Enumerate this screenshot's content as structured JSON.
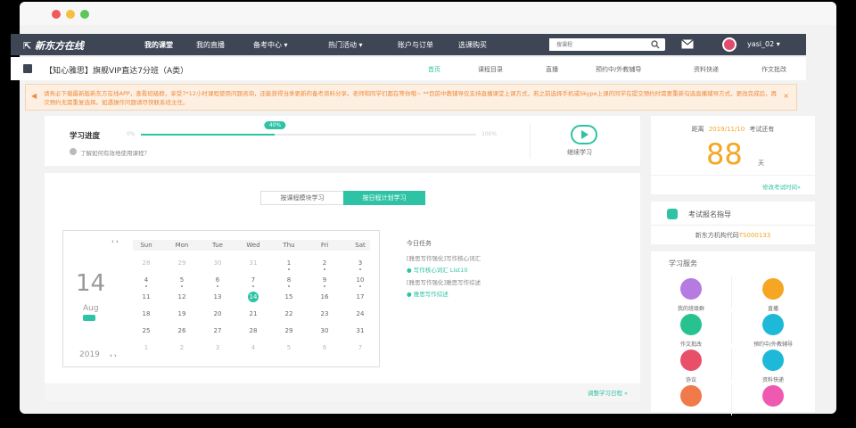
{
  "topnav": {
    "logo": "新东方在线",
    "items": [
      "我的课堂",
      "我的直播",
      "备考中心 ▾",
      "热门活动 ▾",
      "账户与订单",
      "选课购买"
    ],
    "search_placeholder": "搜课程",
    "username": "yasi_02 ▾"
  },
  "subheader": {
    "course_title": "【知心雅思】旗舰VIP直达7分班（A类）",
    "tabs": [
      "首页",
      "课程目录",
      "直播",
      "预约中/外教辅导",
      "资料快递",
      "作文批改"
    ]
  },
  "notice": {
    "text": "请务必下载最新版新东方在线APP，查看班级群，享受7*12小时课程使用问题咨询，还能获得当季更新的备考资料分享。老师和同学们都在等你哦~ **目前中教辅导仅支持直播课堂上课方式，若之前选择手机或Skype上课的同学在提交预约时需要重新勾选直播辅导方式，更改完成后，再次预约无需重复选择。如遇操作问题请尽快联系班主任。",
    "close": "×"
  },
  "progress": {
    "title": "学习进度",
    "percent": 0.4,
    "percent_label": "40%",
    "start_label": "0%",
    "end_label": "100%",
    "help": "了解如何有效地使用课程？",
    "continue": "继续学习"
  },
  "exam": {
    "prefix": "距离",
    "date": "2019/11/10",
    "suffix": "考试还有",
    "days": "88",
    "unit": "天",
    "edit": "修改考试时间»"
  },
  "mode_tabs": [
    "按课程模块学习",
    "按日程计划学习"
  ],
  "calendar": {
    "day": "14",
    "month": "Aug",
    "year": "2019",
    "weekdays": [
      "Sun",
      "Mon",
      "Tue",
      "Wed",
      "Thu",
      "Fri",
      "Sat"
    ],
    "rows": [
      [
        "28",
        "29",
        "30",
        "31",
        "1",
        "2",
        "3"
      ],
      [
        "4",
        "5",
        "6",
        "7",
        "8",
        "9",
        "10"
      ],
      [
        "11",
        "12",
        "13",
        "14",
        "15",
        "16",
        "17"
      ],
      [
        "18",
        "19",
        "20",
        "21",
        "22",
        "23",
        "24"
      ],
      [
        "25",
        "26",
        "27",
        "28",
        "29",
        "30",
        "31"
      ],
      [
        "1",
        "2",
        "3",
        "4",
        "5",
        "6",
        "7"
      ]
    ],
    "nav": "‹ ›"
  },
  "today_tasks": {
    "title": "今日任务",
    "items": [
      {
        "label": "[雅思写作强化]写作核心词汇",
        "link": "写作核心词汇 List10"
      },
      {
        "label": "[雅思写作强化]雅思写作综述",
        "link": "雅思写作综述"
      }
    ]
  },
  "adjust_link": "调整学习日程 »",
  "guidance": {
    "title": "考试报名指导",
    "code_prefix": "新东方机构代码",
    "code": "TS000133"
  },
  "services": {
    "title": "学习服务",
    "items": [
      {
        "label": "我的班级群",
        "color": "#b57be0"
      },
      {
        "label": "直播",
        "color": "#f5a623"
      },
      {
        "label": "作文批改",
        "color": "#27c28f"
      },
      {
        "label": "预约中/外教辅导",
        "color": "#1eb8d8"
      },
      {
        "label": "协议",
        "color": "#e8506a"
      },
      {
        "label": "资料快递",
        "color": "#1eb8d8"
      },
      {
        "label": "",
        "color": "#f07a4a"
      },
      {
        "label": "",
        "color": "#ee5ab0"
      }
    ]
  },
  "colors": {
    "accent": "#2ec3a4",
    "orange": "#f5a623",
    "nav": "#3e4555"
  }
}
